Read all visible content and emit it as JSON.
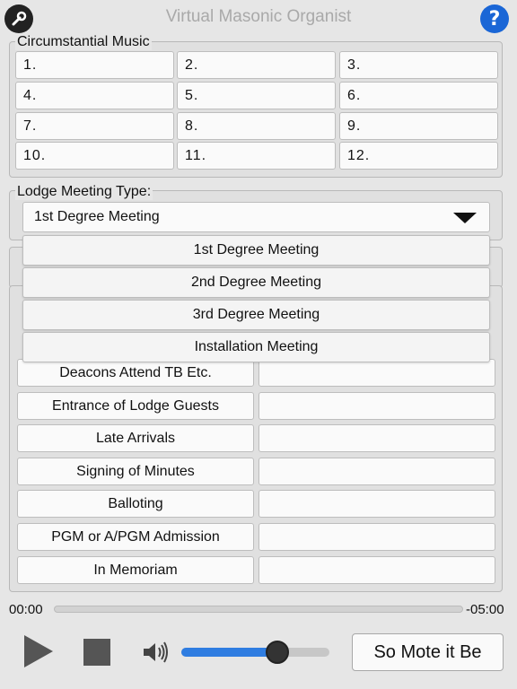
{
  "header": {
    "title": "Virtual Masonic Organist",
    "settings_icon": "wrench-icon",
    "help_icon": "question-mark-icon",
    "help_glyph": "?"
  },
  "circumstantial": {
    "label": "Circumstantial Music",
    "buttons": [
      "1.",
      "2.",
      "3.",
      "4.",
      "5.",
      "6.",
      "7.",
      "8.",
      "9.",
      "10.",
      "11.",
      "12."
    ]
  },
  "lodge_meeting": {
    "label": "Lodge Meeting Type:",
    "selected": "1st Degree Meeting",
    "options": [
      "1st Degree Meeting",
      "2nd Degree Meeting",
      "3rd Degree Meeting",
      "Installation Meeting"
    ]
  },
  "events": {
    "rows": [
      {
        "label": "Deacons Attend TB Etc.",
        "value": ""
      },
      {
        "label": "Entrance of Lodge Guests",
        "value": ""
      },
      {
        "label": "Late Arrivals",
        "value": ""
      },
      {
        "label": "Signing of Minutes",
        "value": ""
      },
      {
        "label": "Balloting",
        "value": ""
      },
      {
        "label": "PGM or A/PGM Admission",
        "value": ""
      },
      {
        "label": "In Memoriam",
        "value": ""
      }
    ]
  },
  "player": {
    "elapsed": "00:00",
    "remaining": "-05:00",
    "progress": 0,
    "volume": 0.65,
    "play_icon": "play-icon",
    "stop_icon": "stop-icon",
    "volume_icon": "speaker-icon",
    "action_label": "So Mote it Be"
  }
}
